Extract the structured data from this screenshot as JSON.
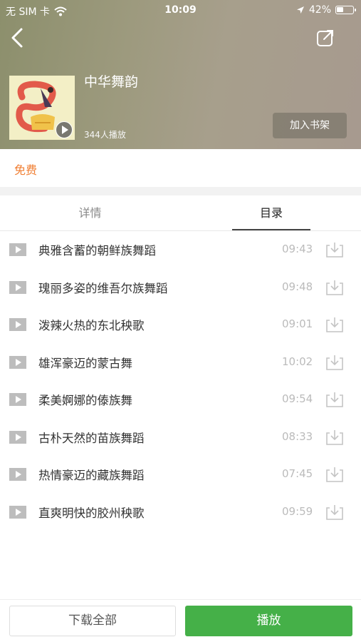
{
  "status_bar": {
    "carrier": "无 SIM 卡",
    "time": "10:09",
    "battery": "42%",
    "battery_level": 0.42
  },
  "header": {
    "back_icon": "chevron-left-icon",
    "share_icon": "share-icon",
    "album_title": "中华舞韵",
    "play_count": "344人播放",
    "add_shelf_label": "加入书架"
  },
  "free_label": "免费",
  "tabs": [
    {
      "label": "详情",
      "active": false
    },
    {
      "label": "目录",
      "active": true
    }
  ],
  "tracks": [
    {
      "title": "典雅含蓄的朝鲜族舞蹈",
      "duration": "09:43"
    },
    {
      "title": "瑰丽多姿的维吾尔族舞蹈",
      "duration": "09:48"
    },
    {
      "title": "泼辣火热的东北秧歌",
      "duration": "09:01"
    },
    {
      "title": "雄浑豪迈的蒙古舞",
      "duration": "10:02"
    },
    {
      "title": "柔美婀娜的傣族舞",
      "duration": "09:54"
    },
    {
      "title": "古朴天然的苗族舞蹈",
      "duration": "08:33"
    },
    {
      "title": "热情豪迈的藏族舞蹈",
      "duration": "07:45"
    },
    {
      "title": "直爽明快的胶州秧歌",
      "duration": "09:59"
    }
  ],
  "bottom": {
    "download_all_label": "下载全部",
    "play_label": "播放"
  },
  "colors": {
    "accent_orange": "#f07e32",
    "play_green": "#45b048"
  }
}
